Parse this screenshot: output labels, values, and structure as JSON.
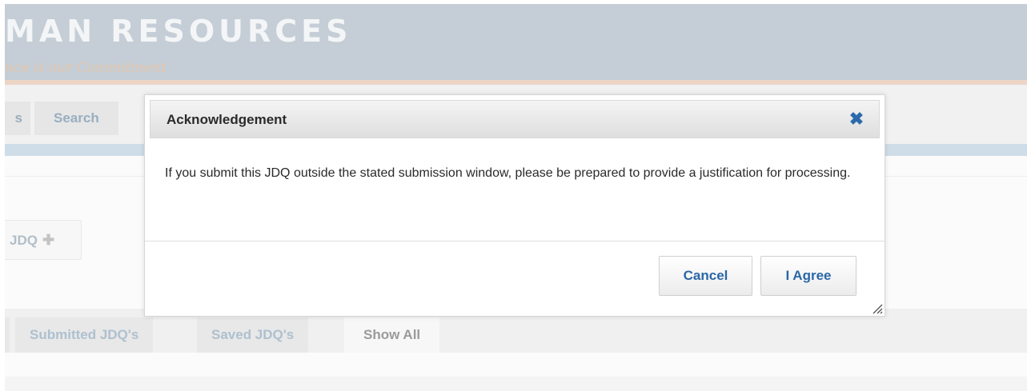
{
  "banner": {
    "title": "MAN RESOURCES",
    "tagline": "nce is our Commitment"
  },
  "nav": {
    "partial_tab": "s",
    "search_tab": "Search"
  },
  "jdq_button": {
    "label": "JDQ",
    "icon": "plus-icon"
  },
  "filter_tabs": {
    "submitted": "Submitted JDQ's",
    "saved": "Saved JDQ's",
    "show_all": "Show All"
  },
  "modal": {
    "title": "Acknowledgement",
    "close_icon": "close-icon",
    "body": "If you submit this JDQ outside the stated submission window, please be prepared to provide a justification for processing.",
    "cancel_label": "Cancel",
    "agree_label": "I Agree"
  },
  "colors": {
    "accent": "#2a67a7",
    "banner": "#c5ced6",
    "nav_bar": "#cfdde8"
  }
}
